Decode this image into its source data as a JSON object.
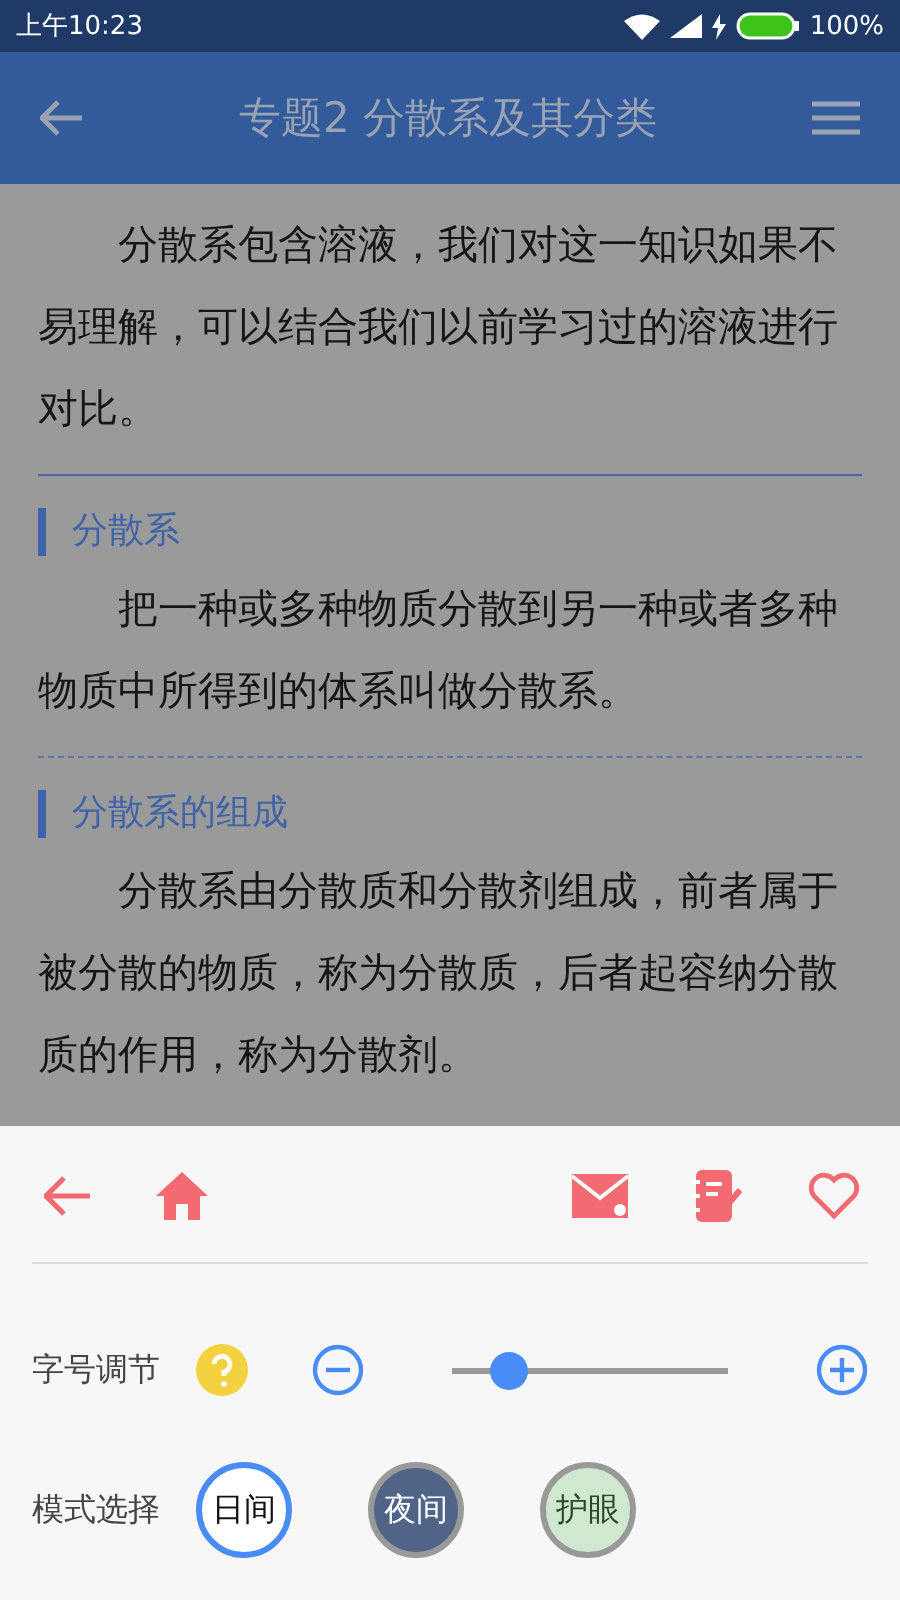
{
  "status_bar": {
    "time": "上午10:23",
    "battery": "100%"
  },
  "app_bar": {
    "title": "专题2 分散系及其分类"
  },
  "content": [
    {
      "kind": "paragraph",
      "text": "分散系包含溶液，我们对这一知识如果不易理解，可以结合我们以前学习过的溶液进行对比。"
    },
    {
      "kind": "solid-rule"
    },
    {
      "kind": "heading",
      "text": "分散系"
    },
    {
      "kind": "paragraph",
      "text": "把一种或多种物质分散到另一种或者多种物质中所得到的体系叫做分散系。"
    },
    {
      "kind": "dashed-rule"
    },
    {
      "kind": "heading",
      "text": "分散系的组成"
    },
    {
      "kind": "paragraph",
      "text": "分散系由分散质和分散剂组成，前者属于被分散的物质，称为分散质，后者起容纳分散质的作用，称为分散剂。"
    }
  ],
  "sheet": {
    "font_size": {
      "label": "字号调节",
      "level": 0.2
    },
    "mode": {
      "label": "模式选择",
      "options": [
        {
          "label": "日间",
          "kind": "day",
          "selected": true
        },
        {
          "label": "夜间",
          "kind": "night",
          "selected": false
        },
        {
          "label": "护眼",
          "kind": "eye",
          "selected": false
        }
      ]
    }
  }
}
